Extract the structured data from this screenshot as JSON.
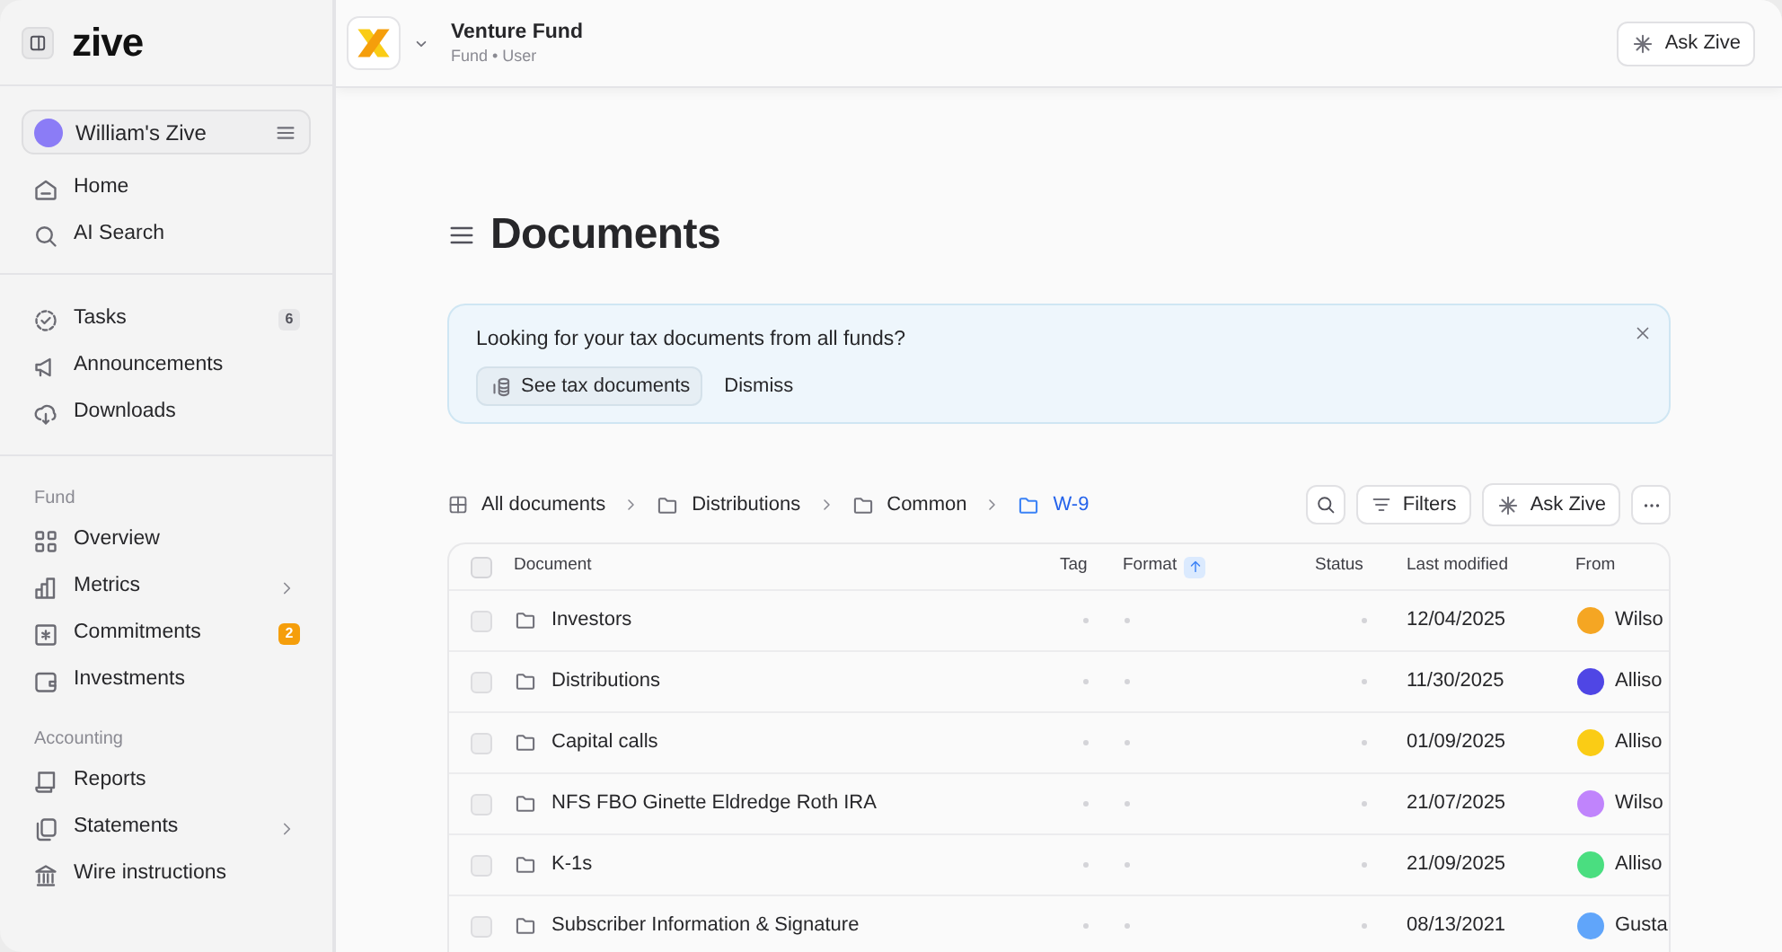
{
  "sidebar": {
    "logo": "zive",
    "workspace": "William's Zive",
    "sections": [
      {
        "items": [
          {
            "label": "Home",
            "expandable": false
          },
          {
            "label": "AI Search",
            "expandable": false
          }
        ]
      },
      {
        "items": [
          {
            "label": "Tasks",
            "count": "6",
            "alert": false,
            "expandable": false
          },
          {
            "label": "Announcements",
            "expandable": false
          },
          {
            "label": "Downloads",
            "expandable": false
          }
        ]
      },
      {
        "heading": "Fund",
        "items": [
          {
            "label": "Overview",
            "expandable": false
          },
          {
            "label": "Metrics",
            "expandable": true
          },
          {
            "label": "Commitments",
            "count": "2",
            "alert": true,
            "expandable": false
          },
          {
            "label": "Investments",
            "expandable": false
          }
        ]
      },
      {
        "heading": "Accounting",
        "items": [
          {
            "label": "Reports",
            "expandable": false
          },
          {
            "label": "Statements",
            "expandable": true
          },
          {
            "label": "Wire instructions",
            "expandable": false
          }
        ]
      }
    ]
  },
  "header": {
    "fund_name": "Venture Fund",
    "subtitle": "Fund • User",
    "ask_button": "Ask Zive"
  },
  "page": {
    "title": "Documents",
    "banner": {
      "message": "Looking for your tax documents from all funds?",
      "primary_button": "See tax documents",
      "secondary_button": "Dismiss"
    },
    "breadcrumb": [
      {
        "label": "All documents",
        "kind": "root",
        "selected": false
      },
      {
        "label": "Distributions",
        "kind": "folder",
        "selected": false
      },
      {
        "label": "Common",
        "kind": "folder",
        "selected": false
      },
      {
        "label": "W-9",
        "kind": "folder",
        "selected": true
      }
    ],
    "toolbar": {
      "filters": "Filters",
      "ask": "Ask Zive"
    },
    "table": {
      "all_checked": false,
      "columns": [
        {
          "label": "Document",
          "sorted": false
        },
        {
          "label": "Tag",
          "sorted": false
        },
        {
          "label": "Format",
          "sorted": true
        },
        {
          "label": "Status",
          "sorted": false
        },
        {
          "label": "Last modified",
          "sorted": false
        },
        {
          "label": "From",
          "sorted": false
        }
      ],
      "rows": [
        {
          "checked": false,
          "name": "Investors",
          "modified": "12/04/2025",
          "from": "Wilso",
          "color": "#f5a623"
        },
        {
          "checked": false,
          "name": "Distributions",
          "modified": "11/30/2025",
          "from": "Alliso",
          "color": "#4f46e5"
        },
        {
          "checked": false,
          "name": "Capital calls",
          "modified": "01/09/2025",
          "from": "Alliso",
          "color": "#facc15"
        },
        {
          "checked": false,
          "name": "NFS FBO Ginette Eldredge Roth IRA",
          "modified": "21/07/2025",
          "from": "Wilso",
          "color": "#c084fc"
        },
        {
          "checked": false,
          "name": "K-1s",
          "modified": "21/09/2025",
          "from": "Alliso",
          "color": "#4ade80"
        },
        {
          "checked": false,
          "name": "Subscriber Information & Signature",
          "modified": "08/13/2021",
          "from": "Gusta",
          "color": "#60a5fa"
        }
      ]
    }
  }
}
